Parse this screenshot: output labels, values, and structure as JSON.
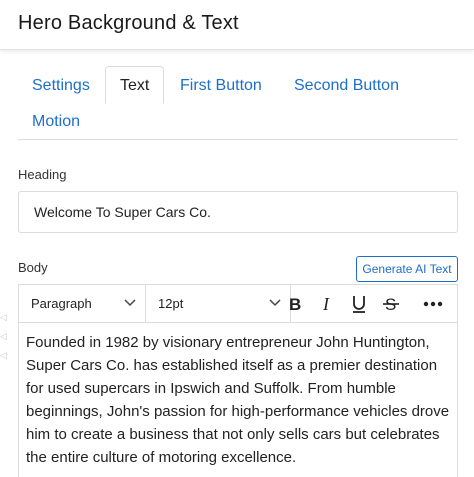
{
  "header": {
    "title": "Hero Background & Text"
  },
  "tabs": [
    {
      "label": "Settings"
    },
    {
      "label": "Text"
    },
    {
      "label": "First Button"
    },
    {
      "label": "Second Button"
    },
    {
      "label": "Motion"
    }
  ],
  "heading": {
    "label": "Heading",
    "value": "Welcome To Super Cars Co."
  },
  "body": {
    "label": "Body",
    "generate_label": "Generate AI Text",
    "block_format": "Paragraph",
    "font_size": "12pt",
    "content": "Founded in 1982 by visionary entrepreneur John Huntington, Super Cars Co. has established itself as a premier destination for used supercars in Ipswich and Suffolk. From humble beginnings, John's passion for high-performance vehicles drove him to create a business that not only sells cars but celebrates the entire culture of motoring excellence."
  },
  "colors": {
    "accent": "#1e6fc8",
    "border": "#dcdcdc"
  }
}
